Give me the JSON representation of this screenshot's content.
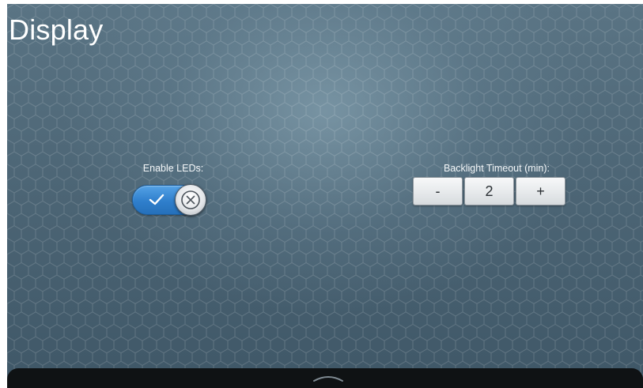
{
  "header": {
    "title": "Display"
  },
  "leds": {
    "label": "Enable LEDs:",
    "enabled": true,
    "icon": "check-icon"
  },
  "backlight": {
    "label": "Backlight Timeout (min):",
    "decrement_label": "-",
    "value": "2",
    "increment_label": "+"
  },
  "navigation": {
    "icon": "chevron-up-icon"
  },
  "colors": {
    "toggle_on": "#2f7fcc",
    "background": "#4d6676",
    "bottom_bar": "#0f1214"
  }
}
